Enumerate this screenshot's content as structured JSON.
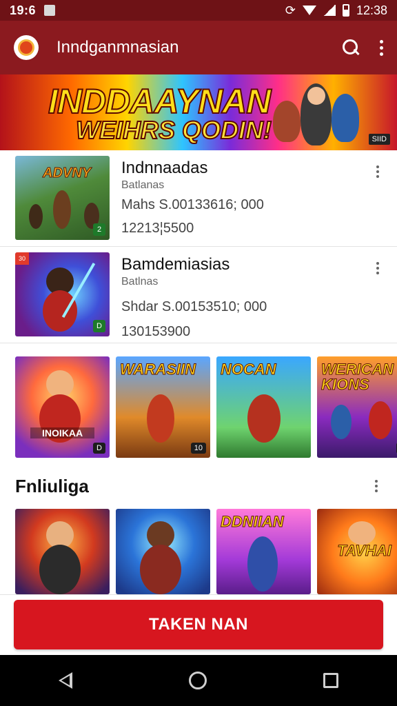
{
  "status_bar": {
    "time": "19:6",
    "clock": "12:38"
  },
  "app_bar": {
    "title": "Inndganmnasian",
    "search_icon": "search-icon",
    "more_icon": "more-vert-icon"
  },
  "banner": {
    "line1": "INDDAAYNAN",
    "line2": "WEIHRS QODIN!",
    "badge": "SIID"
  },
  "list": [
    {
      "title": "Indnnaadas",
      "subtitle": "Batlanas",
      "meta": "Mahs S.00133616; 000",
      "number": "12213¦5500"
    },
    {
      "title": "Bamdemiasias",
      "subtitle": "Batlnas",
      "meta": "Shdar S.00153510; 000",
      "number": "130153900",
      "corner": "30"
    }
  ],
  "gallery1": [
    {
      "title": "",
      "label": "INOIKAA",
      "badge": ""
    },
    {
      "title": "WARASIIN",
      "label": "",
      "badge": "10"
    },
    {
      "title": "NOCAN",
      "label": "",
      "badge": ""
    },
    {
      "title": "WERICAN KIONS",
      "label": "",
      "badge": ""
    }
  ],
  "section": {
    "title": "Fnliuliga"
  },
  "gallery2": [
    {
      "title": "",
      "label": ""
    },
    {
      "title": "",
      "label": ""
    },
    {
      "title": "DDNIIAN",
      "label": ""
    },
    {
      "title": "TAVHAI",
      "label": ""
    }
  ],
  "cta": {
    "label": "TAKEN NAN"
  },
  "colors": {
    "primary": "#8b1a1f",
    "status": "#6e1216",
    "cta": "#d7161f"
  }
}
